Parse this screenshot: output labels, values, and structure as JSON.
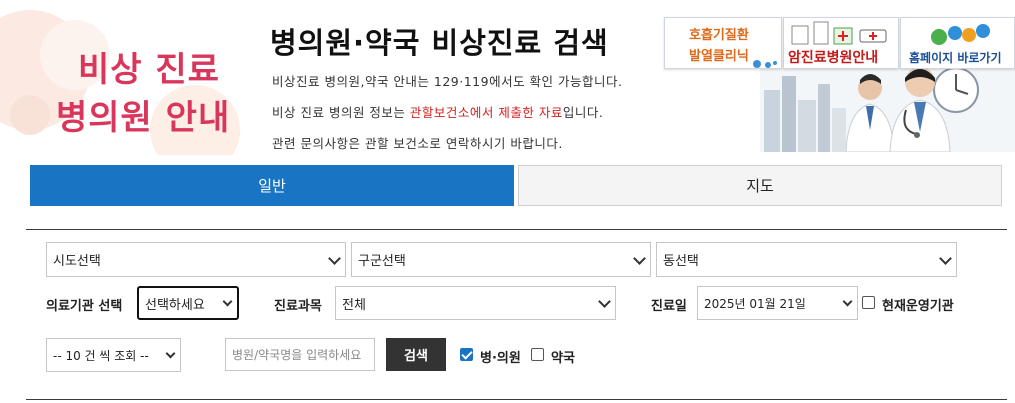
{
  "header": {
    "logo_line1": "비상 진료",
    "logo_line2": "병의원 안내",
    "title": "병의원·약국 비상진료 검색",
    "desc1": "비상진료 병의원,약국 안내는 129·119에서도 확인 가능합니다.",
    "desc2_before": "비상 진료 병의원 정보는 ",
    "desc2_red": "관할보건소에서 제출한 자료",
    "desc2_after": "입니다.",
    "desc3": "관련 문의사항은 관할 보건소로 연락하시기 바랍니다."
  },
  "quick_links": {
    "clinic_line1": "호흡기질환",
    "clinic_line2": "발열클리닉",
    "cancer": "암진료병원안내",
    "homepage": "홈페이지 바로가기"
  },
  "tabs": {
    "general": "일반",
    "map": "지도"
  },
  "form": {
    "sido": "시도선택",
    "gugun": "구군선택",
    "dong": "동선택",
    "institution_label": "의료기관 선택",
    "institution_value": "선택하세요",
    "department_label": "진료과목",
    "department_value": "전체",
    "date_label": "진료일",
    "date_value": "2025년 01월 21일",
    "open_now_label": "현재운영기관",
    "page_size": "-- 10 건 씩 조회 --",
    "search_placeholder": "병원/약국명을 입력하세요",
    "search_button": "검색",
    "hospital_label": "병·의원",
    "pharmacy_label": "약국"
  },
  "colors": {
    "accent": "#1a74c4",
    "logo": "#d9365b",
    "highlight": "#d42020",
    "search_button": "#333333"
  }
}
